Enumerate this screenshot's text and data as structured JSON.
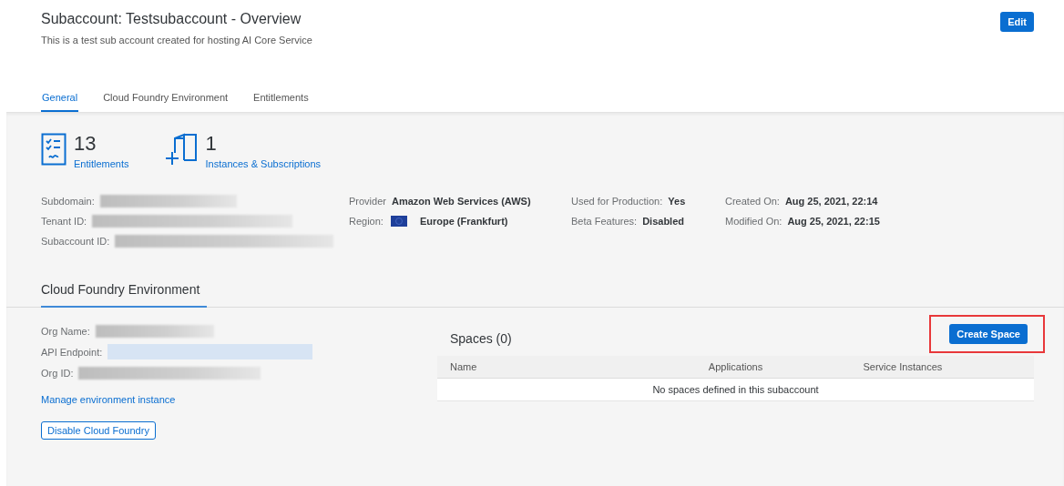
{
  "header": {
    "title": "Subaccount: Testsubaccount - Overview",
    "description": "This is a test sub account created for hosting AI Core Service",
    "edit_button": "Edit"
  },
  "tabs": [
    {
      "label": "General",
      "selected": true
    },
    {
      "label": "Cloud Foundry Environment",
      "selected": false
    },
    {
      "label": "Entitlements",
      "selected": false
    }
  ],
  "tiles": [
    {
      "kind": "entitlements",
      "count": "13",
      "label": "Entitlements"
    },
    {
      "kind": "instances",
      "count": "1",
      "label": "Instances & Subscriptions"
    }
  ],
  "details": [
    [
      {
        "label": "Subdomain:",
        "kind": "redacted"
      },
      {
        "label": "Tenant ID:",
        "kind": "redacted"
      },
      {
        "label": "Subaccount ID:",
        "kind": "redacted"
      }
    ],
    [
      {
        "label": "Provider",
        "kind": "text",
        "value": "Amazon Web Services (AWS)"
      },
      {
        "label": "Region:",
        "kind": "flag",
        "value": "Europe (Frankfurt)"
      }
    ],
    [
      {
        "label": "Used for Production:",
        "kind": "text",
        "value": "Yes"
      },
      {
        "label": "Beta Features:",
        "kind": "text",
        "value": "Disabled"
      }
    ],
    [
      {
        "label": "Created On:",
        "kind": "text",
        "value": "Aug 25, 2021, 22:14"
      },
      {
        "label": "Modified On:",
        "kind": "text",
        "value": "Aug 25, 2021, 22:15"
      }
    ]
  ],
  "cf": {
    "title": "Cloud Foundry Environment",
    "fields": [
      {
        "label": "Org Name:",
        "kind": "redacted"
      },
      {
        "label": "API Endpoint:",
        "kind": "redacted-link"
      },
      {
        "label": "Org ID:",
        "kind": "redacted"
      }
    ],
    "link": "Manage environment instance",
    "disable_button": "Disable Cloud Foundry"
  },
  "spaces": {
    "title": "Spaces (0)",
    "create_button": "Create Space",
    "highlighted": true,
    "columns": [
      "Name",
      "Applications",
      "Service Instances"
    ],
    "empty_text": "No spaces defined in this subaccount"
  }
}
